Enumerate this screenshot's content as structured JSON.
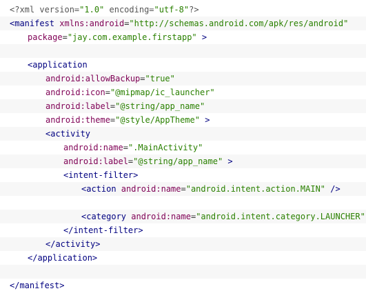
{
  "editor": {
    "theme_colors": {
      "background": "#ffffff",
      "alternate_row": "#f7f7f7",
      "tag": "#000080",
      "attribute": "#7f0055",
      "value": "#2a8000",
      "text": "#333333"
    },
    "lines": [
      {
        "indent": 0,
        "tokens": [
          {
            "t": "muted",
            "text": "<?xml version="
          },
          {
            "t": "val",
            "text": "\"1.0\""
          },
          {
            "t": "muted",
            "text": " encoding="
          },
          {
            "t": "val",
            "text": "\"utf-8\""
          },
          {
            "t": "muted",
            "text": "?>"
          }
        ]
      },
      {
        "indent": 0,
        "tokens": [
          {
            "t": "tag",
            "text": "<manifest"
          },
          {
            "t": "attr",
            "text": " xmlns:android"
          },
          {
            "t": "plain",
            "text": "="
          },
          {
            "t": "val",
            "text": "\"http://schemas.android.com/apk/res/android\""
          }
        ]
      },
      {
        "indent": 1,
        "tokens": [
          {
            "t": "attr",
            "text": "package"
          },
          {
            "t": "plain",
            "text": "="
          },
          {
            "t": "val",
            "text": "\"jay.com.example.firstapp\""
          },
          {
            "t": "tag",
            "text": " >"
          }
        ]
      },
      {
        "indent": 0,
        "tokens": []
      },
      {
        "indent": 1,
        "tokens": [
          {
            "t": "tag",
            "text": "<application"
          }
        ]
      },
      {
        "indent": 2,
        "tokens": [
          {
            "t": "attr",
            "text": "android:allowBackup"
          },
          {
            "t": "plain",
            "text": "="
          },
          {
            "t": "val",
            "text": "\"true\""
          }
        ]
      },
      {
        "indent": 2,
        "tokens": [
          {
            "t": "attr",
            "text": "android:icon"
          },
          {
            "t": "plain",
            "text": "="
          },
          {
            "t": "val",
            "text": "\"@mipmap/ic_launcher\""
          }
        ]
      },
      {
        "indent": 2,
        "tokens": [
          {
            "t": "attr",
            "text": "android:label"
          },
          {
            "t": "plain",
            "text": "="
          },
          {
            "t": "val",
            "text": "\"@string/app_name\""
          }
        ]
      },
      {
        "indent": 2,
        "tokens": [
          {
            "t": "attr",
            "text": "android:theme"
          },
          {
            "t": "plain",
            "text": "="
          },
          {
            "t": "val",
            "text": "\"@style/AppTheme\""
          },
          {
            "t": "tag",
            "text": " >"
          }
        ]
      },
      {
        "indent": 2,
        "tokens": [
          {
            "t": "tag",
            "text": "<activity"
          }
        ]
      },
      {
        "indent": 3,
        "tokens": [
          {
            "t": "attr",
            "text": "android:name"
          },
          {
            "t": "plain",
            "text": "="
          },
          {
            "t": "val",
            "text": "\".MainActivity\""
          }
        ]
      },
      {
        "indent": 3,
        "tokens": [
          {
            "t": "attr",
            "text": "android:label"
          },
          {
            "t": "plain",
            "text": "="
          },
          {
            "t": "val",
            "text": "\"@string/app_name\""
          },
          {
            "t": "tag",
            "text": " >"
          }
        ]
      },
      {
        "indent": 3,
        "tokens": [
          {
            "t": "tag",
            "text": "<intent-filter>"
          }
        ]
      },
      {
        "indent": 4,
        "tokens": [
          {
            "t": "tag",
            "text": "<action"
          },
          {
            "t": "attr",
            "text": " android:name"
          },
          {
            "t": "plain",
            "text": "="
          },
          {
            "t": "val",
            "text": "\"android.intent.action.MAIN\""
          },
          {
            "t": "tag",
            "text": " />"
          }
        ]
      },
      {
        "indent": 0,
        "tokens": []
      },
      {
        "indent": 4,
        "tokens": [
          {
            "t": "tag",
            "text": "<category"
          },
          {
            "t": "attr",
            "text": " android:name"
          },
          {
            "t": "plain",
            "text": "="
          },
          {
            "t": "val",
            "text": "\"android.intent.category.LAUNCHER\""
          },
          {
            "t": "tag",
            "text": " />"
          }
        ]
      },
      {
        "indent": 3,
        "tokens": [
          {
            "t": "tag",
            "text": "</intent-filter>"
          }
        ]
      },
      {
        "indent": 2,
        "tokens": [
          {
            "t": "tag",
            "text": "</activity>"
          }
        ]
      },
      {
        "indent": 1,
        "tokens": [
          {
            "t": "tag",
            "text": "</application>"
          }
        ]
      },
      {
        "indent": 0,
        "tokens": []
      },
      {
        "indent": 0,
        "tokens": [
          {
            "t": "tag",
            "text": "</manifest>"
          }
        ]
      }
    ]
  }
}
